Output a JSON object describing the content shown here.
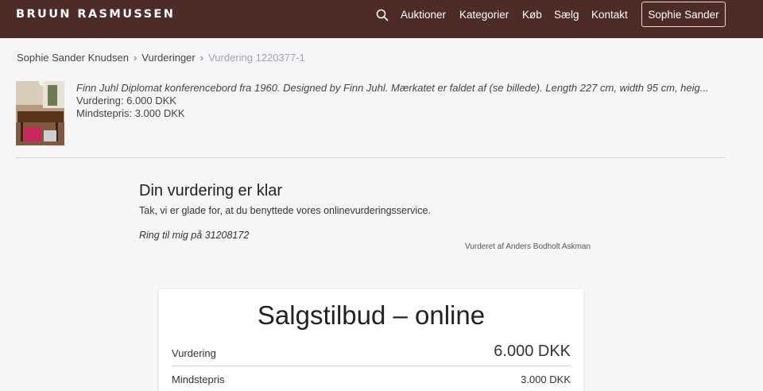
{
  "header": {
    "logo": "BRUUN RASMUSSEN",
    "nav": [
      "Auktioner",
      "Kategorier",
      "Køb",
      "Sælg",
      "Kontakt"
    ],
    "user": "Sophie Sander"
  },
  "breadcrumb": {
    "items": [
      "Sophie Sander Knudsen",
      "Vurderinger"
    ],
    "separator": "›",
    "current": "Vurdering 1220377-1"
  },
  "item": {
    "title": "Finn Juhl Diplomat konferencebord fra 1960. Designed by Finn Juhl. Mærkatet er faldet af (se billede). Length 227 cm, width 95 cm, heig...",
    "valuation": "Vurdering: 6.000 DKK",
    "min_price": "Mindstepris: 3.000 DKK"
  },
  "valuation_result": {
    "heading": "Din vurdering er klar",
    "thanks": "Tak, vi er glade for, at du benyttede vores onlinevurderingsservice.",
    "call": "Ring til mig på 31208172",
    "valued_by": "Vurderet af Anders Bodholt Askman"
  },
  "offer_card": {
    "title": "Salgstilbud – online",
    "rows": [
      {
        "label": "Vurdering",
        "value": "6.000 DKK"
      },
      {
        "label": "Mindstepris",
        "value": "3.000 DKK"
      }
    ]
  }
}
